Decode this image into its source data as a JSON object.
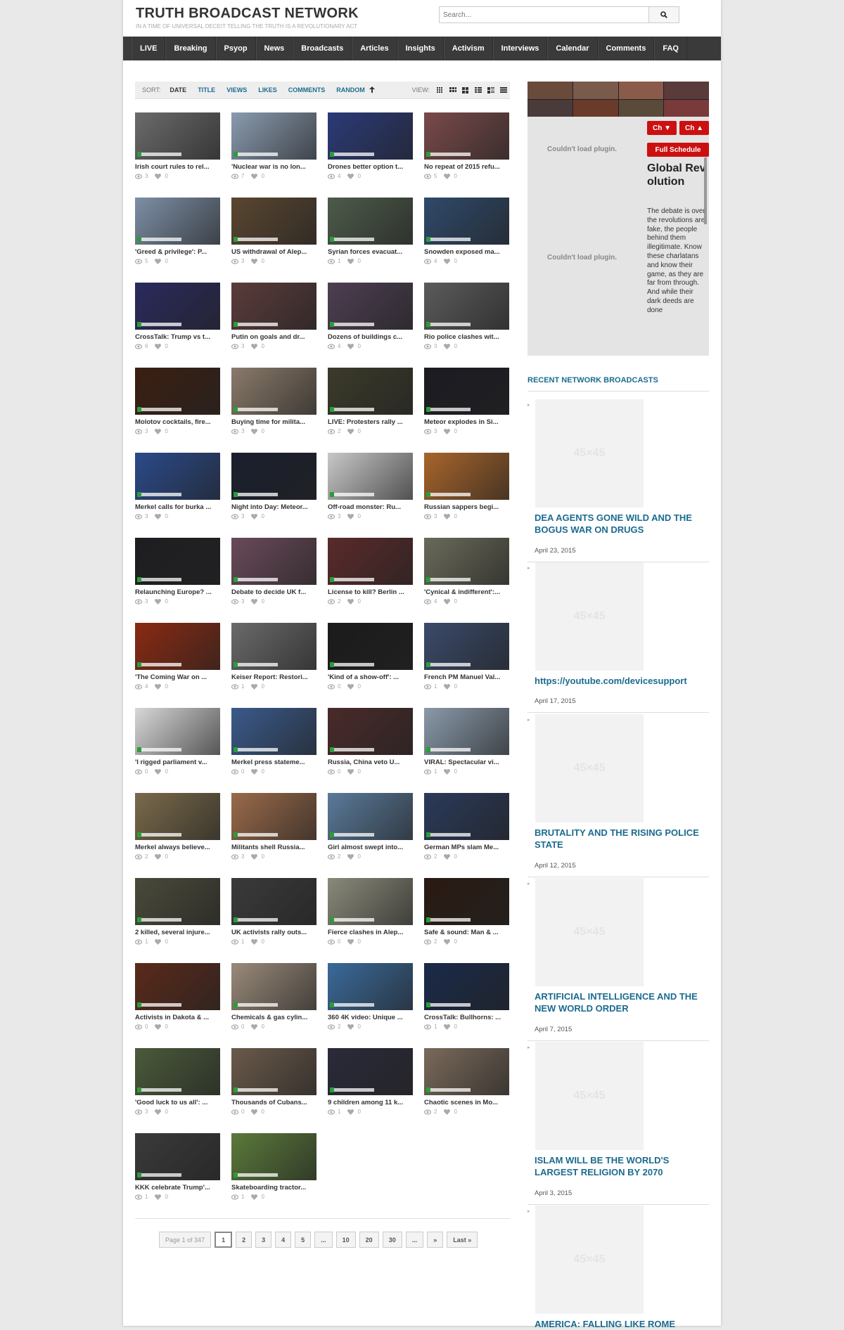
{
  "site": {
    "title": "TRUTH BROADCAST NETWORK",
    "tagline": "IN A TIME OF UNIVERSAL DECEIT TELLING THE TRUTH IS A REVOLUTIONARY ACT",
    "search_placeholder": "Search..."
  },
  "nav": [
    "LIVE",
    "Breaking",
    "Psyop",
    "News",
    "Broadcasts",
    "Articles",
    "Insights",
    "Activism",
    "Interviews",
    "Calendar",
    "Comments",
    "FAQ"
  ],
  "sortbar": {
    "sort_label": "SORT:",
    "options": [
      "DATE",
      "TITLE",
      "VIEWS",
      "LIKES",
      "COMMENTS",
      "RANDOM"
    ],
    "active": "DATE",
    "view_label": "VIEW:"
  },
  "videos": [
    {
      "title": "Irish court rules to rel...",
      "views": "3",
      "likes": "0",
      "color": "#6b6b6b"
    },
    {
      "title": "'Nuclear war is no lon...",
      "views": "7",
      "likes": "0",
      "color": "#8a9bb0"
    },
    {
      "title": "Drones better option t...",
      "views": "4",
      "likes": "0",
      "color": "#2b3a78"
    },
    {
      "title": "No repeat of 2015 refu...",
      "views": "5",
      "likes": "0",
      "color": "#7a4a4a"
    },
    {
      "title": "'Greed & privilege': P...",
      "views": "5",
      "likes": "0",
      "color": "#7d8fa6"
    },
    {
      "title": "US withdrawal of Alep...",
      "views": "3",
      "likes": "0",
      "color": "#5a4630"
    },
    {
      "title": "Syrian forces evacuat...",
      "views": "1",
      "likes": "0",
      "color": "#4d5b4a"
    },
    {
      "title": "Snowden exposed ma...",
      "views": "4",
      "likes": "0",
      "color": "#2f4a6b"
    },
    {
      "title": "CrossTalk: Trump vs t...",
      "views": "6",
      "likes": "0",
      "color": "#2a2a5e"
    },
    {
      "title": "Putin on goals and dr...",
      "views": "3",
      "likes": "0",
      "color": "#5b3b3b"
    },
    {
      "title": "Dozens of buildings c...",
      "views": "4",
      "likes": "0",
      "color": "#4d3f52"
    },
    {
      "title": "Rio police clashes wit...",
      "views": "3",
      "likes": "0",
      "color": "#5b5b5b"
    },
    {
      "title": "Molotov cocktails, fire...",
      "views": "3",
      "likes": "0",
      "color": "#3b1f12"
    },
    {
      "title": "Buying time for milita...",
      "views": "3",
      "likes": "0",
      "color": "#8a7a6a"
    },
    {
      "title": "LIVE: Protesters rally ...",
      "views": "2",
      "likes": "0",
      "color": "#3b3a2a"
    },
    {
      "title": "Meteor explodes in Si...",
      "views": "3",
      "likes": "0",
      "color": "#1b1b22"
    },
    {
      "title": "Merkel calls for burka ...",
      "views": "3",
      "likes": "0",
      "color": "#2a4a8a"
    },
    {
      "title": "Night into Day: Meteor...",
      "views": "3",
      "likes": "0",
      "color": "#1a1f2e"
    },
    {
      "title": "Off-road monster: Ru...",
      "views": "3",
      "likes": "0",
      "color": "#c8c8c8"
    },
    {
      "title": "Russian sappers begi...",
      "views": "3",
      "likes": "0",
      "color": "#a8652a"
    },
    {
      "title": "Relaunching Europe? ...",
      "views": "3",
      "likes": "0",
      "color": "#1e1e22"
    },
    {
      "title": "Debate to decide UK f...",
      "views": "3",
      "likes": "0",
      "color": "#6a4a5a"
    },
    {
      "title": "License to kill? Berlin ...",
      "views": "2",
      "likes": "0",
      "color": "#5a2a2a"
    },
    {
      "title": "'Cynical & indifferent':...",
      "views": "4",
      "likes": "0",
      "color": "#6a6a5a"
    },
    {
      "title": "'The Coming War on ...",
      "views": "4",
      "likes": "0",
      "color": "#8a2a12"
    },
    {
      "title": "Keiser Report: Restori...",
      "views": "1",
      "likes": "0",
      "color": "#6a6a6a"
    },
    {
      "title": "'Kind of a show-off': ...",
      "views": "0",
      "likes": "0",
      "color": "#1b1b1b"
    },
    {
      "title": "French PM Manuel Val...",
      "views": "1",
      "likes": "0",
      "color": "#3a4a6a"
    },
    {
      "title": "'I rigged parliament v...",
      "views": "0",
      "likes": "0",
      "color": "#d8d8d8"
    },
    {
      "title": "Merkel press stateme...",
      "views": "0",
      "likes": "0",
      "color": "#3a5a8a"
    },
    {
      "title": "Russia, China veto U...",
      "views": "0",
      "likes": "0",
      "color": "#4a2a2a"
    },
    {
      "title": "VIRAL: Spectacular vi...",
      "views": "1",
      "likes": "0",
      "color": "#8a9aaa"
    },
    {
      "title": "Merkel always believe...",
      "views": "2",
      "likes": "0",
      "color": "#7a6a4a"
    },
    {
      "title": "Militants shell Russia...",
      "views": "3",
      "likes": "0",
      "color": "#9a6a4a"
    },
    {
      "title": "Girl almost swept into...",
      "views": "2",
      "likes": "0",
      "color": "#5a7a9a"
    },
    {
      "title": "German MPs slam Me...",
      "views": "2",
      "likes": "0",
      "color": "#2a3a5a"
    },
    {
      "title": "2 killed, several injure...",
      "views": "1",
      "likes": "0",
      "color": "#4a4a3a"
    },
    {
      "title": "UK activists rally outs...",
      "views": "1",
      "likes": "0",
      "color": "#3a3a3a"
    },
    {
      "title": "Fierce clashes in Alep...",
      "views": "0",
      "likes": "0",
      "color": "#8a8a7a"
    },
    {
      "title": "Safe & sound: Man & ...",
      "views": "2",
      "likes": "0",
      "color": "#2a1a12"
    },
    {
      "title": "Activists in Dakota & ...",
      "views": "0",
      "likes": "0",
      "color": "#5a2a1a"
    },
    {
      "title": "Chemicals & gas cylin...",
      "views": "0",
      "likes": "0",
      "color": "#9a8a7a"
    },
    {
      "title": "360 4K video: Unique ...",
      "views": "2",
      "likes": "0",
      "color": "#3a6a9a"
    },
    {
      "title": "CrossTalk: Bullhorns: ...",
      "views": "1",
      "likes": "0",
      "color": "#1a2a4a"
    },
    {
      "title": "'Good luck to us all': ...",
      "views": "3",
      "likes": "0",
      "color": "#4a5a3a"
    },
    {
      "title": "Thousands of Cubans...",
      "views": "0",
      "likes": "0",
      "color": "#6a5a4a"
    },
    {
      "title": "9 children among 11 k...",
      "views": "1",
      "likes": "0",
      "color": "#2a2a3a"
    },
    {
      "title": "Chaotic scenes in Mo...",
      "views": "2",
      "likes": "0",
      "color": "#7a6a5a"
    },
    {
      "title": "KKK celebrate Trump'...",
      "views": "1",
      "likes": "0",
      "color": "#3a3a3a"
    },
    {
      "title": "Skateboarding tractor...",
      "views": "1",
      "likes": "0",
      "color": "#5a7a3a"
    }
  ],
  "pagination": [
    "Page 1 of 347",
    "1",
    "2",
    "3",
    "4",
    "5",
    "...",
    "10",
    "20",
    "30",
    "...",
    "»",
    "Last »"
  ],
  "player": {
    "plugin_msg_1": "Couldn't load plugin.",
    "plugin_msg_2": "Couldn't load plugin.",
    "ch_down": "Ch ▼",
    "ch_up": "Ch ▲",
    "schedule_btn": "Full Schedule",
    "schedule_title": "Global Revolution",
    "schedule_text": "The debate is over; the revolutions are fake, the people behind them illegitimate. Know these charlatans and know their game, as they are far from through. And while their dark deeds are done"
  },
  "sidebar": {
    "heading": "RECENT NETWORK BROADCASTS",
    "thumb_placeholder": "45×45",
    "broadcasts": [
      {
        "title": "DEA AGENTS GONE WILD AND THE BOGUS WAR ON DRUGS",
        "date": "April 23, 2015"
      },
      {
        "title": "https://youtube.com/devicesupport",
        "date": "April 17, 2015"
      },
      {
        "title": "BRUTALITY AND THE RISING POLICE STATE",
        "date": "April 12, 2015"
      },
      {
        "title": "ARTIFICIAL INTELLIGENCE AND THE NEW WORLD ORDER",
        "date": "April 7, 2015"
      },
      {
        "title": "ISLAM WILL BE THE WORLD'S LARGEST RELIGION BY 2070",
        "date": "April 3, 2015"
      },
      {
        "title": "AMERICA: FALLING LIKE ROME",
        "date": ""
      }
    ]
  }
}
